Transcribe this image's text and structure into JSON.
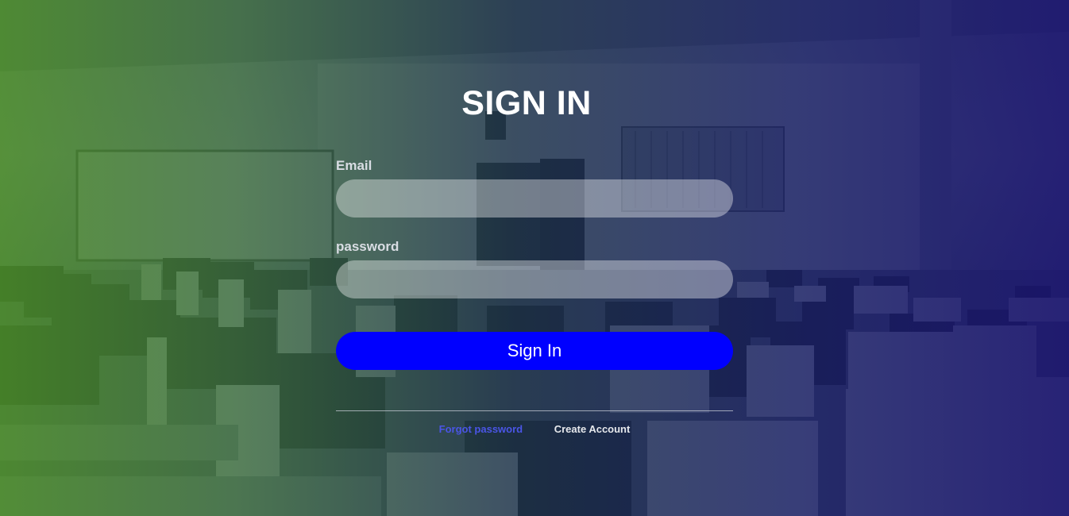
{
  "page": {
    "title": "SIGN IN"
  },
  "form": {
    "email_label": "Email",
    "email_value": "",
    "password_label": "password",
    "password_value": "",
    "signin_label": "Sign In"
  },
  "links": {
    "forgot_label": "Forgot password",
    "create_label": "Create Account"
  },
  "colors": {
    "signin_button": "#0000ff",
    "forgot_link": "#4a55e6",
    "gradient_left": "#4a8c28",
    "gradient_right": "#1a146e"
  }
}
